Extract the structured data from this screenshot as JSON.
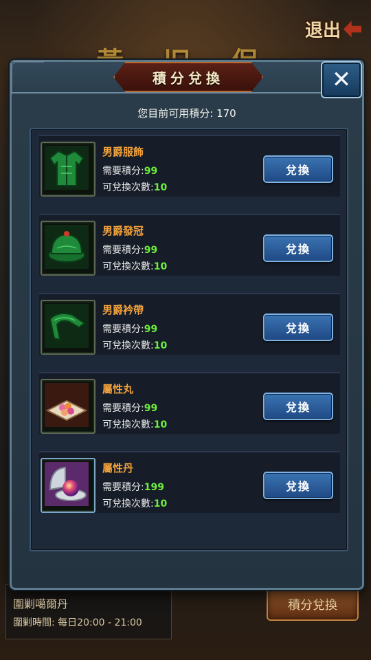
{
  "background": {
    "title_text": "黃 旧 保 十 新",
    "exit_label": "退出",
    "bottom_info_line1": "圍剿噶爾丹",
    "bottom_info_time_label": "圍剿時間:",
    "bottom_info_time_value": "每日20:00 - 21:00",
    "bottom_button": "積分兌換"
  },
  "dialog": {
    "title": "積分兌換",
    "close_glyph": "✕",
    "points_label": "您目前可用積分:",
    "points_value": "170",
    "cost_label": "需要積分:",
    "count_label": "可兌換次數:",
    "button_label": "兌換",
    "items": [
      {
        "name": "男爵服飾",
        "cost": "99",
        "count": "10",
        "icon": "robe-icon"
      },
      {
        "name": "男爵發冠",
        "cost": "99",
        "count": "10",
        "icon": "cap-icon"
      },
      {
        "name": "男爵衿帶",
        "cost": "99",
        "count": "10",
        "icon": "collar-icon"
      },
      {
        "name": "屬性丸",
        "cost": "99",
        "count": "10",
        "icon": "pill-tray-icon"
      },
      {
        "name": "屬性丹",
        "cost": "199",
        "count": "10",
        "icon": "elixir-orb-icon"
      }
    ]
  },
  "colors": {
    "item_name": "#f3a23a",
    "value_green": "#6df03a",
    "button_blue": "#2c5e9c",
    "title_plate": "#4a1810"
  }
}
